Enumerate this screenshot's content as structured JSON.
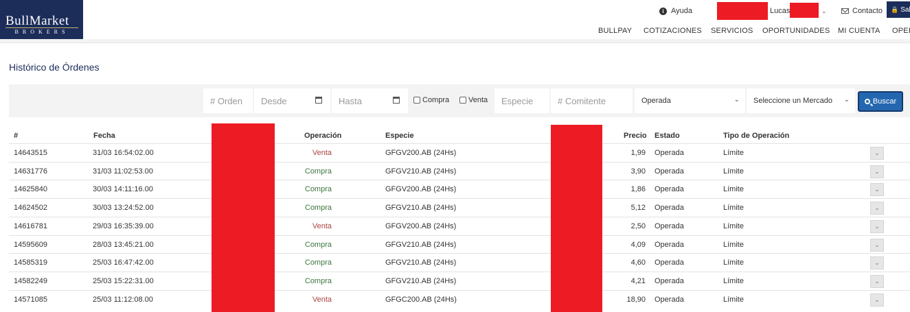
{
  "brand": {
    "name": "BullMarket",
    "sub": "BROKERS"
  },
  "topbar": {
    "help": "Ayuda",
    "user": "Lucas",
    "contact": "Contacto",
    "logout": "Salir"
  },
  "nav": [
    "BULLPAY",
    "COTIZACIONES",
    "SERVICIOS",
    "OPORTUNIDADES",
    "MI CUENTA",
    "OPERAR"
  ],
  "page": {
    "title": "Histórico de Órdenes"
  },
  "filters": {
    "orden_placeholder": "# Orden",
    "desde_placeholder": "Desde",
    "hasta_placeholder": "Hasta",
    "compra_label": "Compra",
    "venta_label": "Venta",
    "especie_placeholder": "Especie",
    "comitente_placeholder": "# Comitente",
    "estado_selected": "Operada",
    "mercado_selected": "Seleccione un Mercado",
    "buscar_label": "Buscar"
  },
  "table": {
    "headers": {
      "num": "#",
      "fecha": "Fecha",
      "operacion": "Operación",
      "especie": "Especie",
      "precio": "Precio",
      "estado": "Estado",
      "tipo": "Tipo de Operación"
    },
    "rows": [
      {
        "num": "14643515",
        "fecha": "31/03 16:54:02.00",
        "operacion": "Venta",
        "especie": "GFGV200.AB (24Hs)",
        "precio": "1,99",
        "estado": "Operada",
        "tipo": "Límite"
      },
      {
        "num": "14631776",
        "fecha": "31/03 11:02:53.00",
        "operacion": "Compra",
        "especie": "GFGV210.AB (24Hs)",
        "precio": "3,90",
        "estado": "Operada",
        "tipo": "Límite"
      },
      {
        "num": "14625840",
        "fecha": "30/03 14:11:16.00",
        "operacion": "Compra",
        "especie": "GFGV200.AB (24Hs)",
        "precio": "1,86",
        "estado": "Operada",
        "tipo": "Límite"
      },
      {
        "num": "14624502",
        "fecha": "30/03 13:24:52.00",
        "operacion": "Compra",
        "especie": "GFGV210.AB (24Hs)",
        "precio": "5,12",
        "estado": "Operada",
        "tipo": "Límite"
      },
      {
        "num": "14616781",
        "fecha": "29/03 16:35:39.00",
        "operacion": "Venta",
        "especie": "GFGV200.AB (24Hs)",
        "precio": "2,50",
        "estado": "Operada",
        "tipo": "Límite"
      },
      {
        "num": "14595609",
        "fecha": "28/03 13:45:21.00",
        "operacion": "Compra",
        "especie": "GFGV210.AB (24Hs)",
        "precio": "4,09",
        "estado": "Operada",
        "tipo": "Límite"
      },
      {
        "num": "14585319",
        "fecha": "25/03 16:47:42.00",
        "operacion": "Compra",
        "especie": "GFGV210.AB (24Hs)",
        "precio": "4,60",
        "estado": "Operada",
        "tipo": "Límite"
      },
      {
        "num": "14582249",
        "fecha": "25/03 15:22:31.00",
        "operacion": "Compra",
        "especie": "GFGV210.AB (24Hs)",
        "precio": "4,21",
        "estado": "Operada",
        "tipo": "Límite"
      },
      {
        "num": "14571085",
        "fecha": "25/03 11:12:08.00",
        "operacion": "Venta",
        "especie": "GFGC200.AB (24Hs)",
        "precio": "18,90",
        "estado": "Operada",
        "tipo": "Límite"
      }
    ]
  },
  "colors": {
    "brand_navy": "#1c2d5a",
    "venta": "#a94442",
    "compra": "#3c763d",
    "redaction": "#ed1c24",
    "buscar": "#2467b0"
  },
  "icons": [
    "help-icon",
    "chevron-down-icon",
    "mail-icon",
    "lock-icon",
    "calendar-icon",
    "search-icon"
  ]
}
